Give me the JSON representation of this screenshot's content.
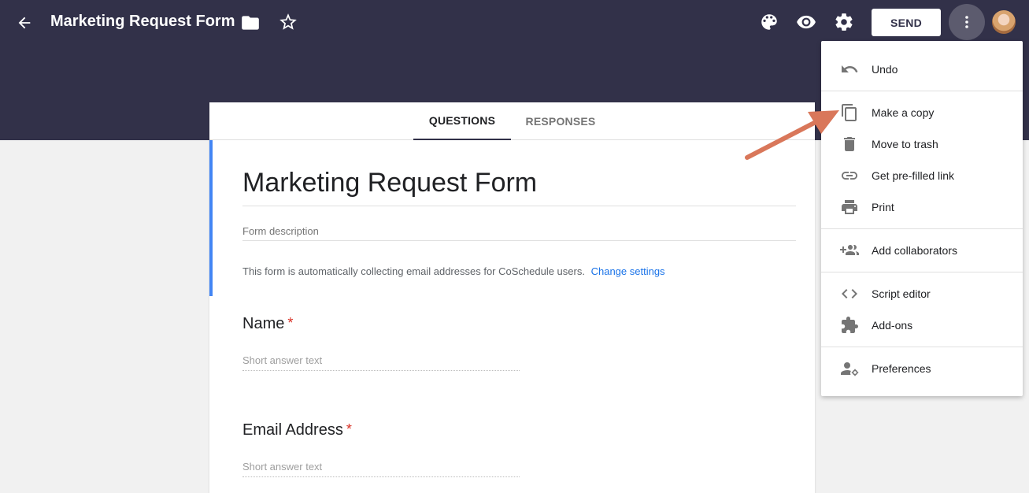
{
  "header": {
    "doc_title": "Marketing Request Form",
    "send_label": "SEND"
  },
  "tabs": [
    {
      "label": "QUESTIONS",
      "active": true
    },
    {
      "label": "RESPONSES",
      "active": false
    }
  ],
  "form": {
    "title": "Marketing Request Form",
    "description_placeholder": "Form description",
    "collect_note": "This form is automatically collecting email addresses for CoSchedule users.",
    "change_settings_label": "Change settings",
    "questions": [
      {
        "title": "Name",
        "required_mark": "*",
        "placeholder": "Short answer text"
      },
      {
        "title": "Email Address",
        "required_mark": "*",
        "placeholder": "Short answer text"
      }
    ]
  },
  "menu": {
    "items": [
      {
        "label": "Undo",
        "icon": "undo-icon"
      },
      {
        "label": "Make a copy",
        "icon": "copy-icon"
      },
      {
        "label": "Move to trash",
        "icon": "trash-icon"
      },
      {
        "label": "Get pre-filled link",
        "icon": "link-icon"
      },
      {
        "label": "Print",
        "icon": "print-icon"
      },
      {
        "label": "Add collaborators",
        "icon": "add-people-icon"
      },
      {
        "label": "Script editor",
        "icon": "code-icon"
      },
      {
        "label": "Add-ons",
        "icon": "puzzle-icon"
      },
      {
        "label": "Preferences",
        "icon": "preferences-icon"
      }
    ]
  },
  "colors": {
    "header_bg": "#323149",
    "accent_blue": "#4285f4",
    "link_blue": "#1a73e8",
    "required_red": "#d93025",
    "annotation_arrow": "#d9775a"
  }
}
